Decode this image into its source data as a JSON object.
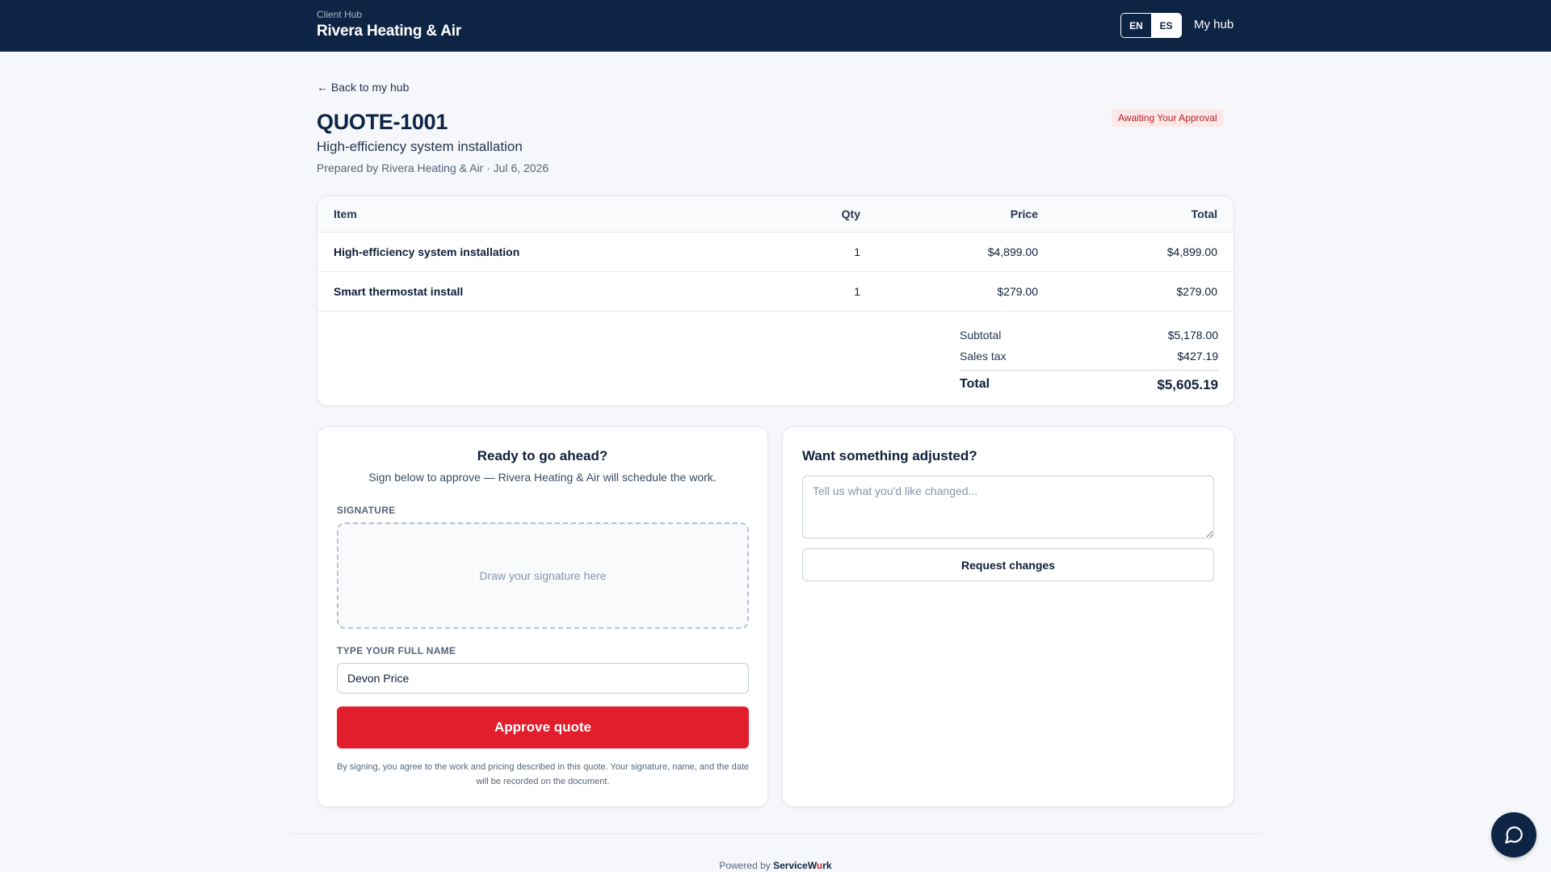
{
  "header": {
    "brand_sub": "Client Hub",
    "brand_name": "Rivera Heating & Air",
    "lang_en": "EN",
    "lang_es": "ES",
    "my_hub": "My hub"
  },
  "quote": {
    "back_link": "← Back to my hub",
    "number": "QUOTE-1001",
    "subtitle": "High-efficiency system installation",
    "prepared": "Prepared by Rivera Heating & Air · Jul 6, 2026",
    "status": "Awaiting Your Approval"
  },
  "table": {
    "headers": {
      "item": "Item",
      "qty": "Qty",
      "price": "Price",
      "total": "Total"
    },
    "rows": [
      {
        "item": "High-efficiency system installation",
        "qty": "1",
        "price": "$4,899.00",
        "total": "$4,899.00"
      },
      {
        "item": "Smart thermostat install",
        "qty": "1",
        "price": "$279.00",
        "total": "$279.00"
      }
    ],
    "subtotal_label": "Subtotal",
    "subtotal": "$5,178.00",
    "tax_label": "Sales tax",
    "tax": "$427.19",
    "total_label": "Total",
    "total": "$5,605.19"
  },
  "approve": {
    "heading": "Ready to go ahead?",
    "text": "Sign below to approve — Rivera Heating & Air will schedule the work.",
    "signature_label": "SIGNATURE",
    "signature_placeholder": "Draw your signature here",
    "name_label": "TYPE YOUR FULL NAME",
    "name_value": "Devon Price",
    "button": "Approve quote",
    "disclaimer": "By signing, you agree to the work and pricing described in this quote. Your signature, name, and the date will be recorded on the document."
  },
  "adjust": {
    "heading": "Want something adjusted?",
    "placeholder": "Tell us what you'd like changed...",
    "button": "Request changes"
  },
  "footer": {
    "powered_by": "Powered by",
    "brand_a": "ServiceW",
    "brand_u": "u",
    "brand_b": "rk"
  },
  "colors": {
    "navy": "#0e2444",
    "accent_red": "#e21d2c",
    "badge_bg": "#fde8e8",
    "badge_text": "#b3242b"
  },
  "icons": {
    "chat": "chat-bubble-icon"
  }
}
